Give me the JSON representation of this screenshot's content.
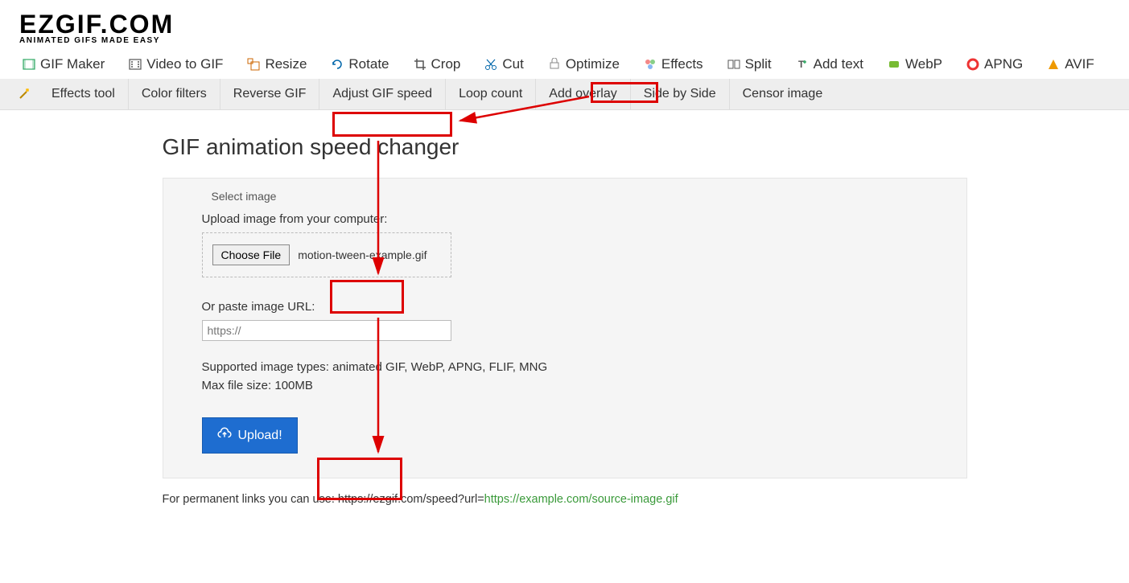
{
  "logo": {
    "title": "EZGIF.COM",
    "subtitle": "ANIMATED GIFS MADE EASY"
  },
  "nav_main": [
    {
      "label": "GIF Maker"
    },
    {
      "label": "Video to GIF"
    },
    {
      "label": "Resize"
    },
    {
      "label": "Rotate"
    },
    {
      "label": "Crop"
    },
    {
      "label": "Cut"
    },
    {
      "label": "Optimize"
    },
    {
      "label": "Effects"
    },
    {
      "label": "Split"
    },
    {
      "label": "Add text"
    },
    {
      "label": "WebP"
    },
    {
      "label": "APNG"
    },
    {
      "label": "AVIF"
    }
  ],
  "nav_sub": [
    {
      "label": "Effects tool"
    },
    {
      "label": "Color filters"
    },
    {
      "label": "Reverse GIF"
    },
    {
      "label": "Adjust GIF speed"
    },
    {
      "label": "Loop count"
    },
    {
      "label": "Add overlay"
    },
    {
      "label": "Side by Side"
    },
    {
      "label": "Censor image"
    }
  ],
  "page": {
    "title": "GIF animation speed changer",
    "fieldset_legend": "Select image",
    "upload_label": "Upload image from your computer:",
    "choose_file_label": "Choose File",
    "selected_file": "motion-tween-example.gif",
    "url_label": "Or paste image URL:",
    "url_placeholder": "https://",
    "supported_line1": "Supported image types: animated GIF, WebP, APNG, FLIF, MNG",
    "supported_line2": "Max file size: 100MB",
    "upload_button": "Upload!",
    "footer_prefix": "For permanent links you can use: https://ezgif.com/speed?url=",
    "footer_link": "https://example.com/source-image.gif"
  }
}
